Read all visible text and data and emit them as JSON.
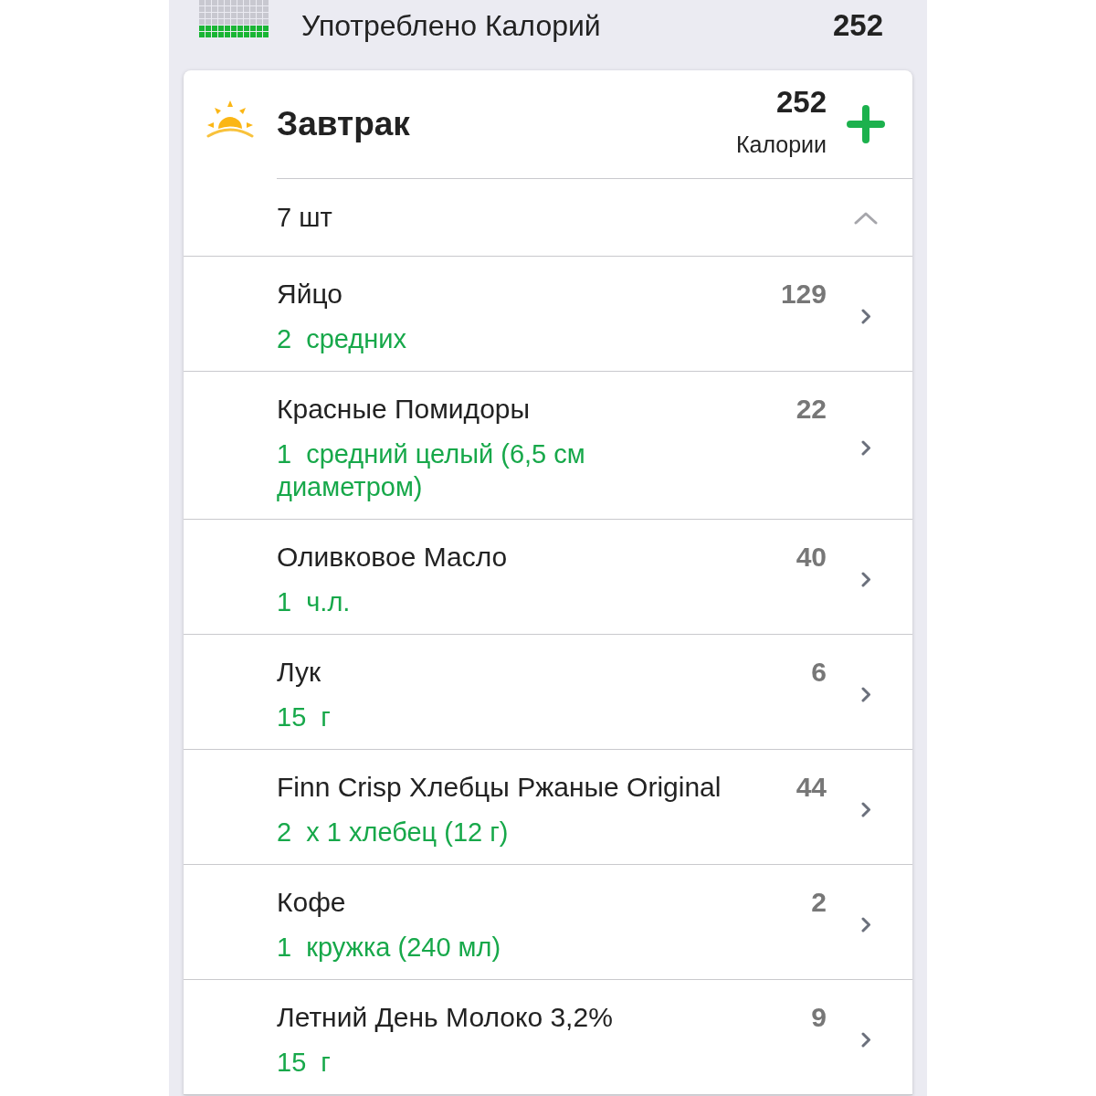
{
  "summary": {
    "label": "Употреблено Калорий",
    "value": "252"
  },
  "meal": {
    "title": "Завтрак",
    "calories": "252",
    "calories_label": "Калории",
    "count": "7 шт",
    "expanded": true,
    "items": [
      {
        "name": "Яйцо",
        "serving": "2  средних",
        "calories": "129"
      },
      {
        "name": "Красные Помидоры",
        "serving": "1  средний целый (6,5 см диаметром)",
        "calories": "22"
      },
      {
        "name": "Оливковое Масло",
        "serving": "1  ч.л.",
        "calories": "40"
      },
      {
        "name": "Лук",
        "serving": "15  г",
        "calories": "6"
      },
      {
        "name": "Finn Crisp Хлебцы Ржаные Original",
        "serving": "2  x 1 хлебец (12 г)",
        "calories": "44"
      },
      {
        "name": "Кофе",
        "serving": "1  кружка (240 мл)",
        "calories": "2"
      },
      {
        "name": "Летний День Молоко 3,2%",
        "serving": "15  г",
        "calories": "9"
      }
    ]
  }
}
